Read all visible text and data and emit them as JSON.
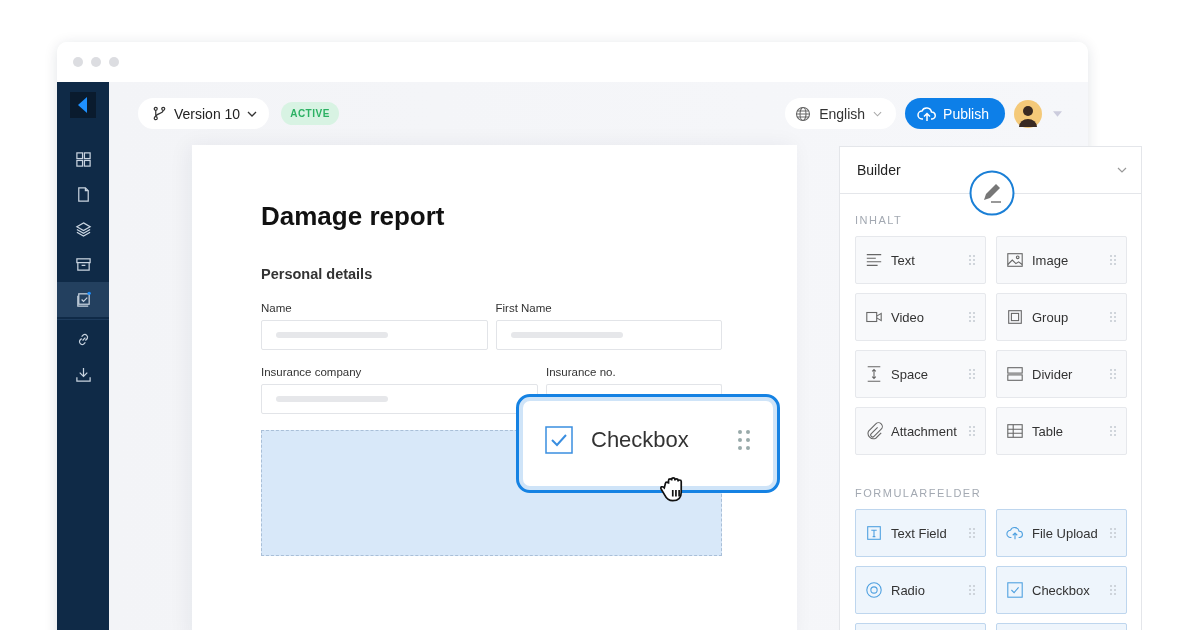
{
  "sidebar": {
    "items": [
      {
        "kind": "grid",
        "selected": false
      },
      {
        "kind": "page",
        "selected": false
      },
      {
        "kind": "layers",
        "selected": false
      },
      {
        "kind": "archive",
        "selected": false
      },
      {
        "kind": "form",
        "selected": true
      },
      {
        "kind": "link",
        "selected": false
      },
      {
        "kind": "download",
        "selected": false
      }
    ]
  },
  "toolbar": {
    "version": "Version 10",
    "status": "ACTIVE",
    "language": "English",
    "publish": "Publish"
  },
  "form": {
    "title": "Damage report",
    "section": "Personal details",
    "rows": [
      [
        {
          "label": "Name"
        },
        {
          "label": "First Name"
        }
      ],
      [
        {
          "label": "Insurance company"
        },
        {
          "label": "Insurance no."
        }
      ]
    ]
  },
  "drag_item": {
    "label": "Checkbox",
    "checked": true
  },
  "builder": {
    "title": "Builder",
    "groups": [
      {
        "heading": "INHALT",
        "kind": "content",
        "items": [
          {
            "kind": "text",
            "label": "Text"
          },
          {
            "kind": "image",
            "label": "Image"
          },
          {
            "kind": "video",
            "label": "Video"
          },
          {
            "kind": "group",
            "label": "Group"
          },
          {
            "kind": "space",
            "label": "Space"
          },
          {
            "kind": "divider",
            "label": "Divider"
          },
          {
            "kind": "attachment",
            "label": "Attachment"
          },
          {
            "kind": "table",
            "label": "Table"
          }
        ]
      },
      {
        "heading": "FORMULARFELDER",
        "kind": "fields",
        "items": [
          {
            "kind": "textfield",
            "label": "Text Field"
          },
          {
            "kind": "upload",
            "label": "File Upload"
          },
          {
            "kind": "radio",
            "label": "Radio"
          },
          {
            "kind": "checkbox",
            "label": "Checkbox"
          },
          {
            "kind": "blank"
          },
          {
            "kind": "blank"
          }
        ]
      }
    ]
  }
}
